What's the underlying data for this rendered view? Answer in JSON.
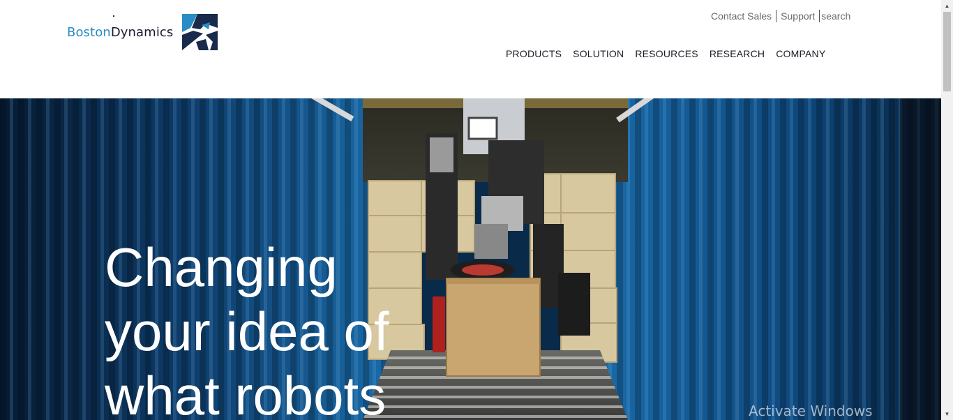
{
  "brand": {
    "name_part1": "Boston",
    "name_part2": "Dynamics",
    "colors": {
      "blue": "#2a8cc4",
      "navy": "#1a2a4a"
    }
  },
  "utility_nav": {
    "contact_sales": "Contact Sales",
    "support": "Support",
    "search": "search"
  },
  "main_nav": [
    {
      "label": "PRODUCTS"
    },
    {
      "label": "SOLUTION"
    },
    {
      "label": "RESOURCES"
    },
    {
      "label": "RESEARCH"
    },
    {
      "label": "COMPANY"
    }
  ],
  "hero": {
    "headline_line1": "Changing",
    "headline_line2": "your idea of",
    "headline_line3": "what robots",
    "image_subject": "robot arm unloading boxes in a shipping container"
  },
  "overlay": {
    "watermark": "Activate Windows"
  },
  "scrollbar": {
    "up_icon": "scroll-up-arrow-icon",
    "down_icon": "scroll-down-arrow-icon"
  }
}
